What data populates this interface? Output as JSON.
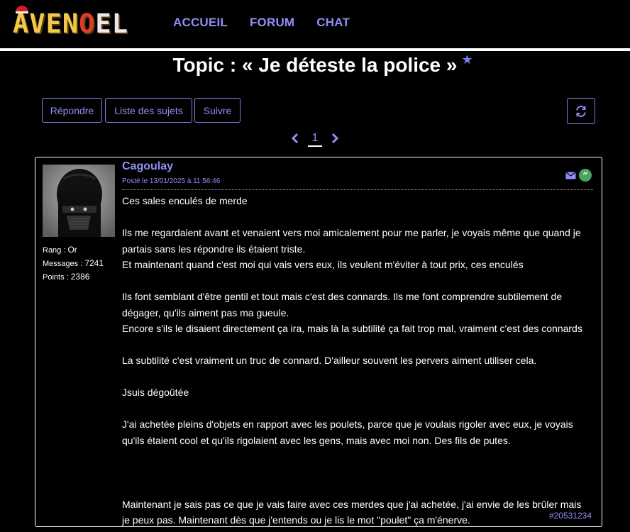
{
  "header": {
    "logo_text": "AVENOEL",
    "nav": [
      "ACCUEIL",
      "FORUM",
      "CHAT"
    ]
  },
  "topic": {
    "title": "Topic : « Je déteste la police »",
    "star_icon": "star-icon"
  },
  "toolbar": {
    "reply_label": "Répondre",
    "subjects_label": "Liste des sujets",
    "follow_label": "Suivre",
    "refresh_icon": "refresh-icon"
  },
  "pagination": {
    "current_page": "1",
    "prev_icon": "chevron-left-icon",
    "next_icon": "chevron-right-icon"
  },
  "post": {
    "author": "Cagoulay",
    "date": "Posté le 13/01/2025 à 11:56:46",
    "rank_label": "Rang",
    "rank_value": "Or",
    "messages_label": "Messages",
    "messages_value": "7241",
    "points_label": "Points",
    "points_value": "2386",
    "id": "#20531234",
    "mail_icon": "envelope-icon",
    "quote_icon": "quote-icon",
    "paragraphs": [
      [
        "Ces sales enculés de merde"
      ],
      [
        "Ils me regardaient avant et venaient vers moi amicalement pour me parler, je voyais même que quand je partais sans les répondre ils étaient triste.",
        "Et maintenant quand c'est moi qui vais vers eux, ils veulent m'éviter à tout prix, ces enculés"
      ],
      [
        "Ils font semblant d'être gentil et tout mais c'est des connards. Ils me font comprendre subtilement de dégager, qu'ils aiment pas ma gueule.",
        "Encore s'ils le disaient directement ça ira, mais là la subtilité ça fait trop mal, vraiment c'est des connards"
      ],
      [
        "La subtilité c'est vraiment un truc de connard. D'ailleur souvent les pervers aiment utiliser cela."
      ],
      [
        "Jsuis dégoûtée"
      ],
      [
        "J'ai achetée pleins d'objets en rapport avec les poulets, parce que je voulais rigoler avec eux, je voyais qu'ils étaient cool et qu'ils rigolaient avec les gens, mais avec moi non. Des fils de putes."
      ],
      [
        ""
      ],
      [
        "Maintenant je sais pas ce que je vais faire avec ces merdes que j'ai achetée, j'ai envie de les brûler mais je peux pas. Maintenant dès que j'entends ou je lis le mot \"poulet\" ça m'énerve."
      ]
    ]
  },
  "colors": {
    "accent": "#8f8ff5",
    "background": "#000000",
    "quote_green": "#4aa564"
  }
}
